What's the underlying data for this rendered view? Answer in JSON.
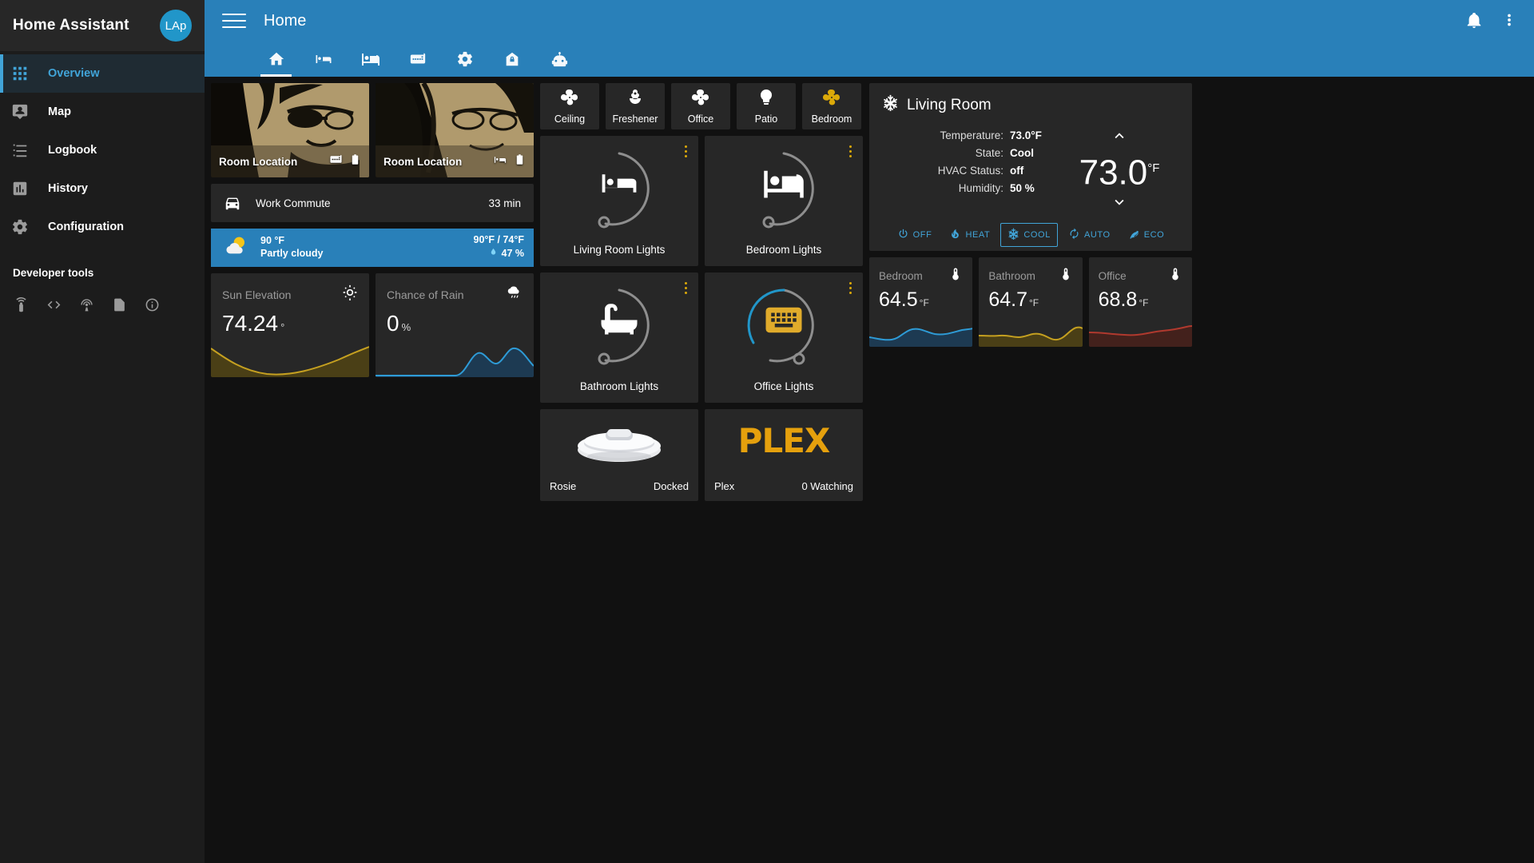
{
  "sidebar": {
    "title": "Home Assistant",
    "avatar_initials": "LAp",
    "items": [
      {
        "label": "Overview",
        "icon": "grid-icon"
      },
      {
        "label": "Map",
        "icon": "account-badge-icon"
      },
      {
        "label": "Logbook",
        "icon": "format-list-icon"
      },
      {
        "label": "History",
        "icon": "chart-box-icon"
      },
      {
        "label": "Configuration",
        "icon": "gear-icon"
      }
    ],
    "developer_tools_label": "Developer tools",
    "developer_icons": [
      "remote-icon",
      "code-tags-icon",
      "broadcast-icon",
      "file-code-icon",
      "information-icon"
    ]
  },
  "header": {
    "title": "Home",
    "menu_icon": "hamburger-icon",
    "notifications_icon": "bell-icon",
    "overflow_icon": "dots-vertical-icon",
    "tabs": [
      {
        "name": "home",
        "icon": "home-icon",
        "active": true
      },
      {
        "name": "living-room",
        "icon": "sofa-icon",
        "active": false
      },
      {
        "name": "bedroom",
        "icon": "bed-icon",
        "active": false
      },
      {
        "name": "office",
        "icon": "keyboard-icon",
        "active": false
      },
      {
        "name": "settings",
        "icon": "gear-icon",
        "active": false
      },
      {
        "name": "security",
        "icon": "home-lock-icon",
        "active": false
      },
      {
        "name": "vacuum",
        "icon": "robot-icon",
        "active": false
      }
    ]
  },
  "persons": [
    {
      "name": "Room Location",
      "status_icons": [
        "keyboard-icon",
        "battery-icon"
      ]
    },
    {
      "name": "Room Location",
      "status_icons": [
        "sofa-icon",
        "battery-icon"
      ]
    }
  ],
  "commute": {
    "icon": "car-icon",
    "name": "Work Commute",
    "value": "33 min"
  },
  "weather": {
    "icon": "partly-cloudy-icon",
    "temperature": "90 °F",
    "condition": "Partly cloudy",
    "range": "90°F / 74°F",
    "humidity_icon": "water-icon",
    "humidity": "47 %"
  },
  "sensors": [
    {
      "title": "Sun Elevation",
      "icon": "sun-icon",
      "value": "74.24",
      "unit": "°",
      "color": "#c5a020"
    },
    {
      "title": "Chance of Rain",
      "icon": "rain-icon",
      "value": "0",
      "unit": "%",
      "color": "#2980b9"
    }
  ],
  "fans": [
    {
      "label": "Ceiling",
      "icon": "fan-icon",
      "on": false
    },
    {
      "label": "Freshener",
      "icon": "flower-icon",
      "on": false
    },
    {
      "label": "Office",
      "icon": "fan-icon",
      "on": false
    },
    {
      "label": "Patio",
      "icon": "bulb-icon",
      "on": false
    },
    {
      "label": "Bedroom",
      "icon": "fan-icon",
      "on": true
    }
  ],
  "lights": [
    {
      "label": "Living Room Lights",
      "icon": "sofa-icon",
      "brightness": 0,
      "ring_color": "#8e8e8e",
      "menu_icon": "dots-vertical-icon"
    },
    {
      "label": "Bedroom Lights",
      "icon": "bed-icon",
      "brightness": 0,
      "ring_color": "#8e8e8e",
      "menu_icon": "dots-vertical-icon"
    },
    {
      "label": "Bathroom Lights",
      "icon": "bathtub-icon",
      "brightness": 0,
      "ring_color": "#8e8e8e",
      "menu_icon": "dots-vertical-icon"
    },
    {
      "label": "Office Lights",
      "icon": "keyboard-icon",
      "brightness": 62,
      "ring_color": "#2196c9",
      "menu_icon": "dots-vertical-icon"
    }
  ],
  "tiles": [
    {
      "name": "Rosie",
      "value": "Docked",
      "image": "vacuum-robot-image"
    },
    {
      "name": "Plex",
      "value": "0 Watching",
      "image": "plex-logo",
      "logo_text": "PLE",
      "logo_accent": "X"
    }
  ],
  "thermostat": {
    "icon": "snowflake-icon",
    "title": "Living Room",
    "rows": [
      {
        "key": "Temperature:",
        "value": "73.0°F"
      },
      {
        "key": "State:",
        "value": "Cool"
      },
      {
        "key": "HVAC Status:",
        "value": "off"
      },
      {
        "key": "Humidity:",
        "value": "50 %"
      }
    ],
    "up_icon": "chevron-up-icon",
    "down_icon": "chevron-down-icon",
    "target_temp": "73.0",
    "target_unit": "°F",
    "modes": [
      {
        "label": "OFF",
        "icon": "power-icon",
        "active": false
      },
      {
        "label": "HEAT",
        "icon": "fire-icon",
        "active": false
      },
      {
        "label": "COOL",
        "icon": "snowflake-icon",
        "active": true
      },
      {
        "label": "AUTO",
        "icon": "autorenew-icon",
        "active": false
      },
      {
        "label": "ECO",
        "icon": "leaf-icon",
        "active": false
      }
    ]
  },
  "temp_sensors": [
    {
      "title": "Bedroom",
      "icon": "thermometer-icon",
      "value": "64.5",
      "unit": "°F",
      "color": "#2980b9"
    },
    {
      "title": "Bathroom",
      "icon": "thermometer-icon",
      "value": "64.7",
      "unit": "°F",
      "color": "#c5a020"
    },
    {
      "title": "Office",
      "icon": "thermometer-icon",
      "value": "68.8",
      "unit": "°F",
      "color": "#b0392e"
    }
  ],
  "colors": {
    "accent": "#2980b9",
    "active_blue": "#41a4d8",
    "amber": "#dba909",
    "card_bg": "#272727",
    "page_bg": "#111111"
  }
}
